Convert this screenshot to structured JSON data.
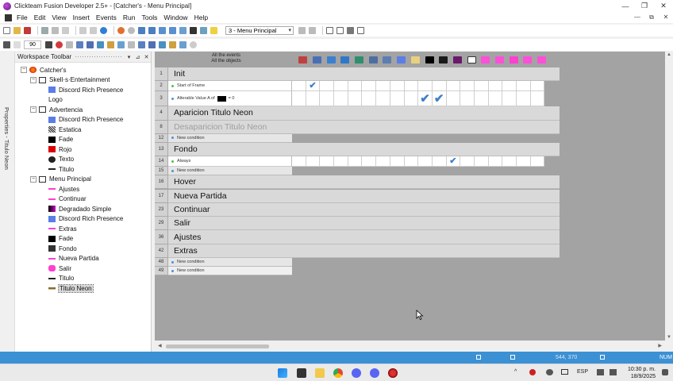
{
  "window": {
    "title": "Clickteam Fusion Developer 2.5+ - [Catcher's - Menu Principal]",
    "controls": [
      "—",
      "❐",
      "✕"
    ]
  },
  "menu": {
    "items": [
      "File",
      "Edit",
      "View",
      "Insert",
      "Events",
      "Run",
      "Tools",
      "Window",
      "Help"
    ],
    "mdi_controls": [
      "—",
      "⧉",
      "✕"
    ]
  },
  "toolbar": {
    "frame_select_value": "3 - Menu Principal",
    "zoom_value": "90"
  },
  "properties_tab": {
    "label": "Properties - Titulo Neon"
  },
  "workspace": {
    "title": "Workspace Toolbar",
    "header_buttons": [
      "▾",
      "⊿",
      "✕"
    ],
    "tree": [
      {
        "label": "Catcher's",
        "level": 0,
        "expander": "−",
        "icon": "app-icon"
      },
      {
        "label": "Skell·s·Entertainment",
        "level": 1,
        "expander": "−",
        "icon": "frame-icon"
      },
      {
        "label": "Discord Rich Presence",
        "level": 2,
        "icon": "extension-icon"
      },
      {
        "label": "Logo",
        "level": 2,
        "icon": "none"
      },
      {
        "label": "Advertencia",
        "level": 1,
        "expander": "−",
        "icon": "frame-icon"
      },
      {
        "label": "Discord Rich Presence",
        "level": 2,
        "icon": "extension-icon"
      },
      {
        "label": "Estatica",
        "level": 2,
        "icon": "active-object-icon"
      },
      {
        "label": "Fade",
        "level": 2,
        "icon": "black-box-icon"
      },
      {
        "label": "Rojo",
        "level": 2,
        "icon": "red-box-icon"
      },
      {
        "label": "Texto",
        "level": 2,
        "icon": "text-icon"
      },
      {
        "label": "Titulo",
        "level": 2,
        "icon": "line-icon"
      },
      {
        "label": "Menu Principal",
        "level": 1,
        "expander": "−",
        "icon": "frame-icon"
      },
      {
        "label": "Ajustes",
        "level": 2,
        "icon": "pink-line-icon"
      },
      {
        "label": "Continuar",
        "level": 2,
        "icon": "pink-line-icon"
      },
      {
        "label": "Degradado Simple",
        "level": 2,
        "icon": "gradient-icon"
      },
      {
        "label": "Discord Rich Presence",
        "level": 2,
        "icon": "extension-icon"
      },
      {
        "label": "Extras",
        "level": 2,
        "icon": "pink-line-icon"
      },
      {
        "label": "Fade",
        "level": 2,
        "icon": "black-box-icon"
      },
      {
        "label": "Fondo",
        "level": 2,
        "icon": "dark-box-icon"
      },
      {
        "label": "Nueva Partida",
        "level": 2,
        "icon": "pink-line-icon"
      },
      {
        "label": "Salir",
        "level": 2,
        "icon": "pink-blob-icon"
      },
      {
        "label": "Titulo",
        "level": 2,
        "icon": "line-icon"
      },
      {
        "label": "Titulo Neon",
        "level": 2,
        "icon": "neon-icon",
        "selected": true
      }
    ]
  },
  "event_editor": {
    "all_events_label": "All the events",
    "all_objects_label": "All the objects",
    "object_columns": [
      {
        "icon": "special-conditions-icon",
        "color": "#c04040"
      },
      {
        "icon": "sound-icon",
        "color": "#4a6fb5"
      },
      {
        "icon": "storyboard-icon",
        "color": "#3a7fd0"
      },
      {
        "icon": "timer-icon",
        "color": "#2f78c8"
      },
      {
        "icon": "create-icon",
        "color": "#2e8f6e"
      },
      {
        "icon": "mouse-icon",
        "color": "#4d6f9f"
      },
      {
        "icon": "player-icon",
        "color": "#5a7fb0"
      },
      {
        "icon": "discord-icon",
        "color": "#5b7de6"
      },
      {
        "icon": "logo-line-icon",
        "color": "#e8d080"
      },
      {
        "icon": "fade-icon",
        "color": "#000000"
      },
      {
        "icon": "fondo-icon",
        "color": "#1a1a1a"
      },
      {
        "icon": "degradado-icon",
        "color": "#6a1a6a"
      },
      {
        "icon": "counter-icon",
        "color": "#ffffff"
      },
      {
        "icon": "nueva-partida-icon",
        "color": "#ff4fd8"
      },
      {
        "icon": "continuar-icon",
        "color": "#ff4fd8"
      },
      {
        "icon": "salir-icon",
        "color": "#ff3fcf"
      },
      {
        "icon": "ajustes-icon",
        "color": "#ff4fd8"
      },
      {
        "icon": "extras-icon",
        "color": "#ff4fd8"
      }
    ],
    "rows": [
      {
        "num": "1",
        "type": "group",
        "text": "Init"
      },
      {
        "num": "2",
        "type": "event",
        "text": "Start of Frame",
        "dot": "#4fbf4f",
        "ticks": [
          1
        ]
      },
      {
        "num": "3",
        "type": "event",
        "text_before": "Alterable Value A of",
        "text_after": "= 0",
        "swatch": true,
        "dot": "#4f8fe0",
        "ticks": [
          9,
          10
        ],
        "big": true
      },
      {
        "num": "4",
        "type": "group",
        "text": "Aparicion Titulo Neon"
      },
      {
        "num": "8",
        "type": "group",
        "text": "Desaparicion Titulo Neon",
        "disabled": true
      },
      {
        "num": "12",
        "type": "newcond",
        "text": "New condition"
      },
      {
        "num": "13",
        "type": "group",
        "text": "Fondo"
      },
      {
        "num": "14",
        "type": "event",
        "text": "Always",
        "dot": "#4fbf4f",
        "ticks": [
          11
        ]
      },
      {
        "num": "15",
        "type": "newcond",
        "text": "New condition"
      },
      {
        "num": "16",
        "type": "group",
        "text": "Hover"
      },
      {
        "num": "17",
        "type": "group",
        "text": "Nueva Partida"
      },
      {
        "num": "23",
        "type": "group",
        "text": "Continuar"
      },
      {
        "num": "29",
        "type": "group",
        "text": "Salir"
      },
      {
        "num": "36",
        "type": "group",
        "text": "Ajustes"
      },
      {
        "num": "42",
        "type": "group",
        "text": "Extras"
      },
      {
        "num": "48",
        "type": "newcond",
        "text": "New condition"
      },
      {
        "num": "49",
        "type": "newcond",
        "text": "New condition",
        "root": true
      }
    ]
  },
  "statusbar": {
    "num_label": "NUM",
    "coords": "544, 370"
  },
  "taskbar": {
    "tray_lang": "ESP",
    "time": "10:30 p. m.",
    "date": "18/9/2025"
  }
}
